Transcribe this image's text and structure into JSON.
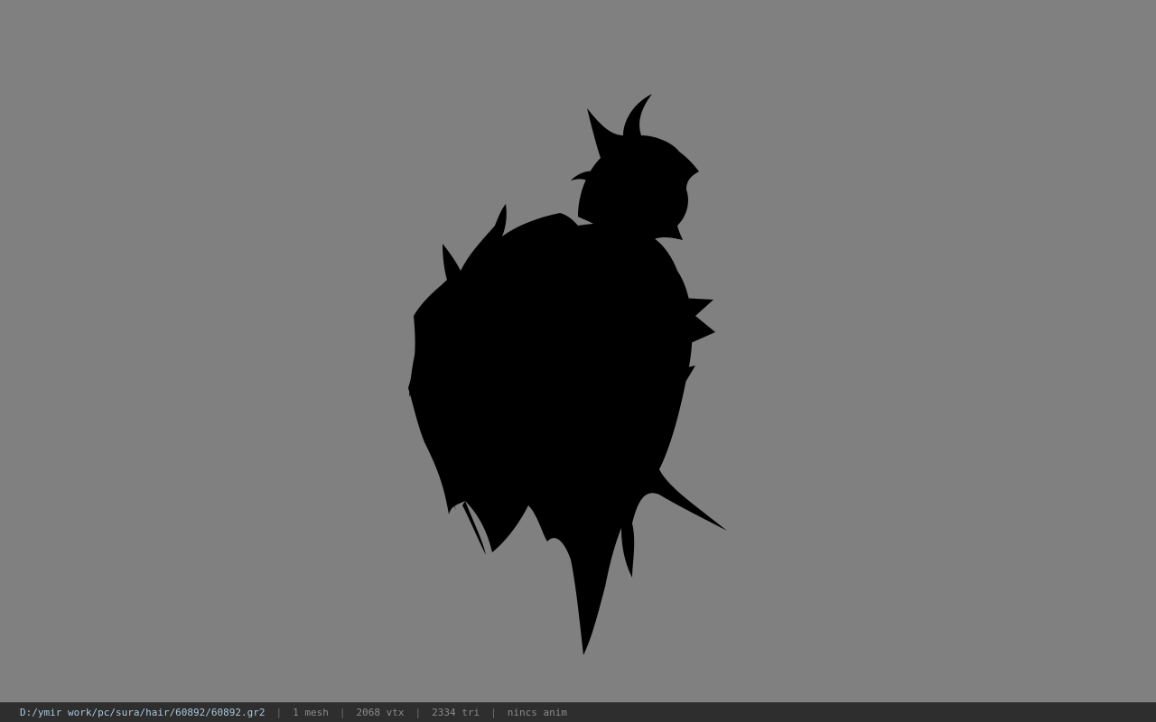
{
  "viewport": {
    "background": "#808080",
    "model_color": "#000000"
  },
  "status": {
    "file_path": "D:/ymir work/pc/sura/hair/60892/60892.gr2",
    "separator": "|",
    "mesh_count": "1 mesh",
    "vertex_count": "2068 vtx",
    "triangle_count": "2334 tri",
    "anim_status": "nincs anim"
  }
}
